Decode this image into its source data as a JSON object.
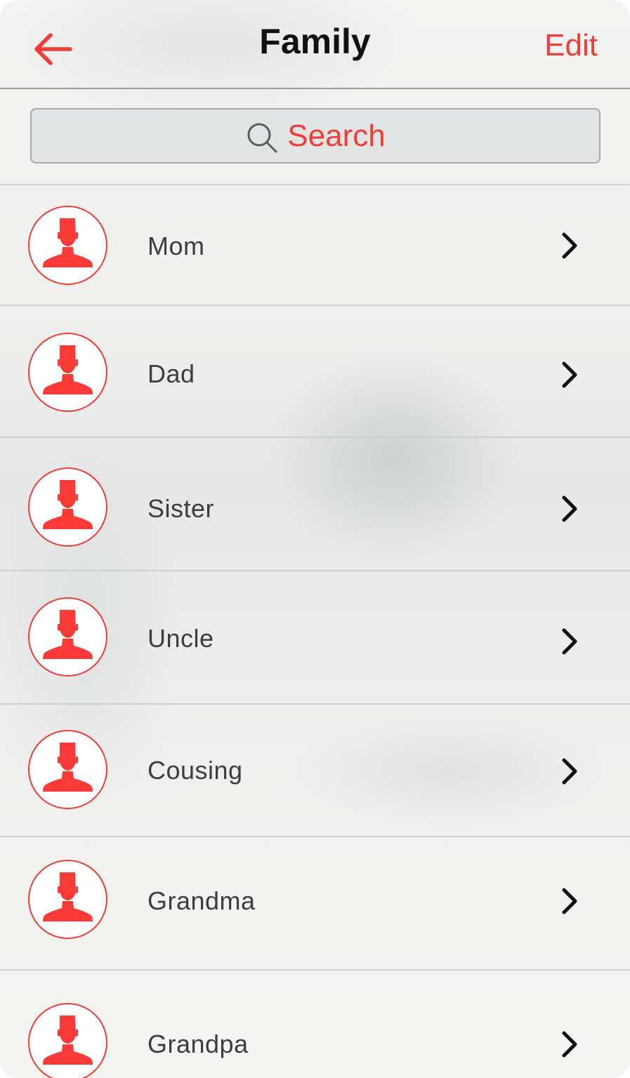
{
  "header": {
    "title": "Family",
    "edit_label": "Edit"
  },
  "search": {
    "placeholder": "Search"
  },
  "contacts": [
    {
      "name": "Mom"
    },
    {
      "name": "Dad"
    },
    {
      "name": "Sister"
    },
    {
      "name": "Uncle"
    },
    {
      "name": "Cousing"
    },
    {
      "name": "Grandma"
    },
    {
      "name": "Grandpa"
    }
  ],
  "colors": {
    "accent": "#ef3e36",
    "title": "#111111",
    "text": "#3b3d40",
    "chevron": "#111111"
  },
  "icons": {
    "back": "arrow-left-icon",
    "search": "magnifier-icon",
    "avatar": "person-silhouette-icon",
    "row_disclosure": "chevron-right-icon"
  }
}
